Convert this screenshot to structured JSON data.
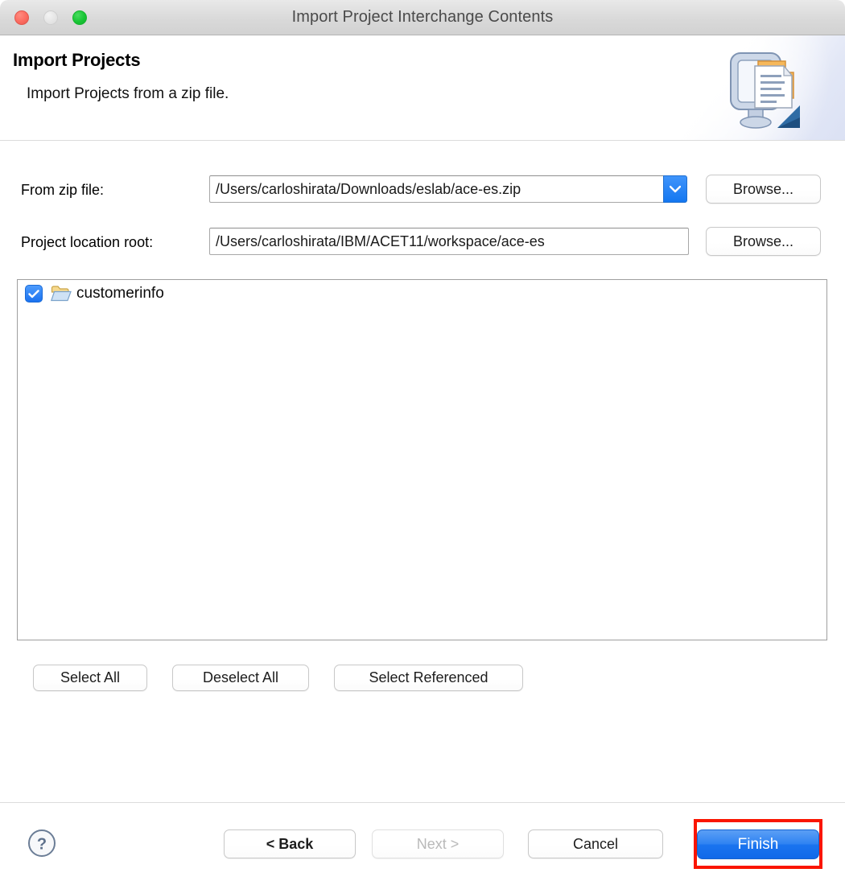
{
  "window": {
    "title": "Import Project Interchange Contents",
    "traffic_lights": {
      "close": "close-button",
      "minimize": "minimize-button",
      "maximize": "maximize-button"
    }
  },
  "banner": {
    "title": "Import Projects",
    "subtitle": "Import Projects from a zip file.",
    "icon": "import-wizard-icon"
  },
  "form": {
    "zip": {
      "label": "From zip file:",
      "value": "/Users/carloshirata/Downloads/eslab/ace-es.zip",
      "placeholder": "",
      "dropdown_icon": "chevron-down-icon",
      "browse_label": "Browse..."
    },
    "root": {
      "label": "Project location root:",
      "value": "/Users/carloshirata/IBM/ACET11/workspace/ace-es",
      "placeholder": "",
      "browse_label": "Browse..."
    }
  },
  "tree": {
    "items": [
      {
        "label": "customerinfo",
        "checked": true,
        "icon": "open-folder-icon"
      }
    ]
  },
  "selection_buttons": {
    "select_all": "Select All",
    "deselect_all": "Deselect All",
    "select_referenced": "Select Referenced"
  },
  "footer": {
    "help_icon": "help-icon",
    "back": "< Back",
    "next": "Next >",
    "cancel": "Cancel",
    "finish": "Finish",
    "next_disabled": true
  },
  "colors": {
    "accent_blue": "#1a74ef",
    "highlight_red": "#fa1500",
    "checkbox_blue": "#1a72ef",
    "titlebar_gray": "#d9d9d9"
  }
}
